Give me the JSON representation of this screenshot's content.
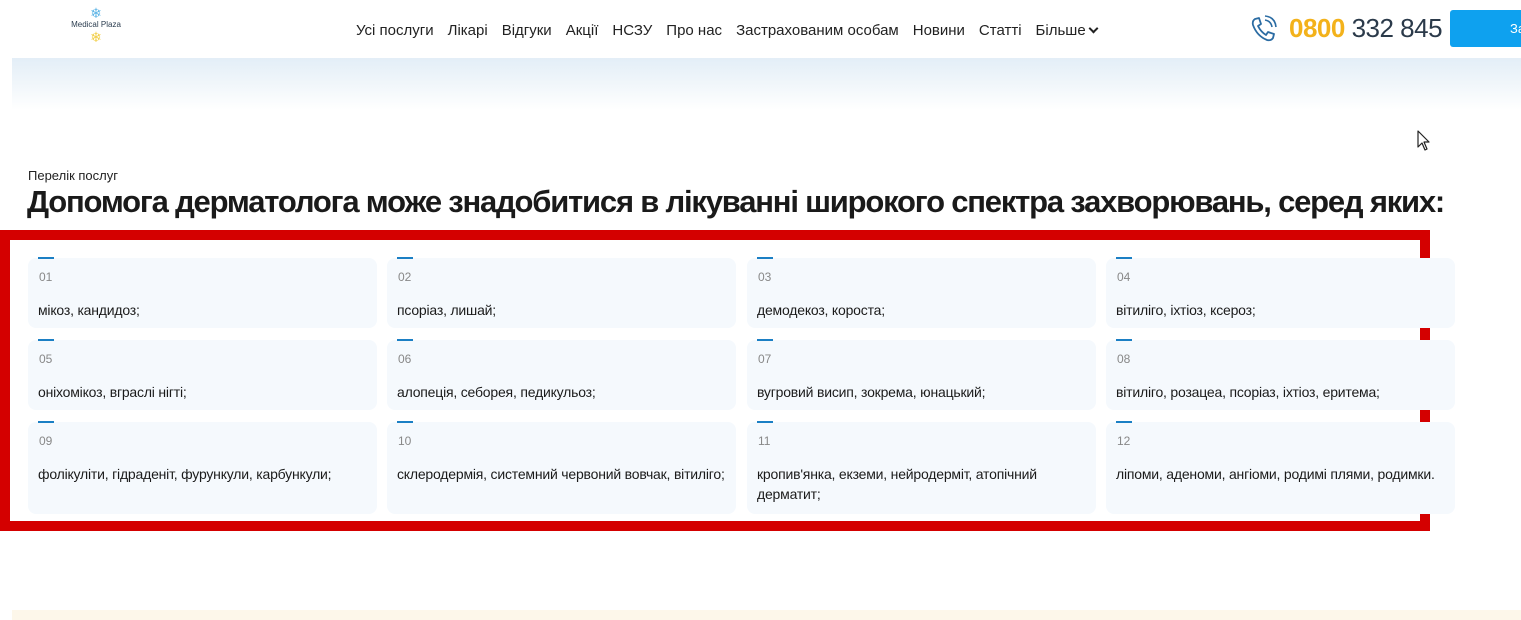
{
  "logo": {
    "text": "Medical Plaza"
  },
  "nav": {
    "items": [
      "Усі послуги",
      "Лікарі",
      "Відгуки",
      "Акції",
      "НСЗУ",
      "Про нас",
      "Застрахованим особам",
      "Новини",
      "Статті"
    ],
    "more_label": "Більше"
  },
  "contact": {
    "phone_code": "0800",
    "phone_number": "332 845",
    "cta_label": "За"
  },
  "section": {
    "subtitle": "Перелік послуг",
    "title": "Допомога дерматолога може знадобитися в лікуванні широкого спектра захворювань, серед яких:"
  },
  "services": [
    {
      "num": "01",
      "text": "мікоз, кандидоз;"
    },
    {
      "num": "02",
      "text": "псоріаз, лишай;"
    },
    {
      "num": "03",
      "text": "демодекоз, короста;"
    },
    {
      "num": "04",
      "text": "вітиліго, іхтіоз, ксероз;"
    },
    {
      "num": "05",
      "text": "оніхомікоз, вграслі нігті;"
    },
    {
      "num": "06",
      "text": "алопеція, себорея, педикульоз;"
    },
    {
      "num": "07",
      "text": "вугровий висип, зокрема, юнацький;"
    },
    {
      "num": "08",
      "text": "вітиліго, розацеа, псоріаз, іхтіоз, еритема;"
    },
    {
      "num": "09",
      "text": "фолікуліти, гідраденіт, фурункули, карбункули;"
    },
    {
      "num": "10",
      "text": "склеродермія, системний червоний вовчак, вітиліго;"
    },
    {
      "num": "11",
      "text": "кропив'янка, екземи, нейродерміт, атопічний дерматит;"
    },
    {
      "num": "12",
      "text": "ліпоми, аденоми, ангіоми, родимі плями, родимки."
    }
  ],
  "colors": {
    "accent": "#0ea1ef",
    "phone_code": "#f3b21b",
    "highlight": "#d40000",
    "card_bg": "#f5f9fd"
  }
}
